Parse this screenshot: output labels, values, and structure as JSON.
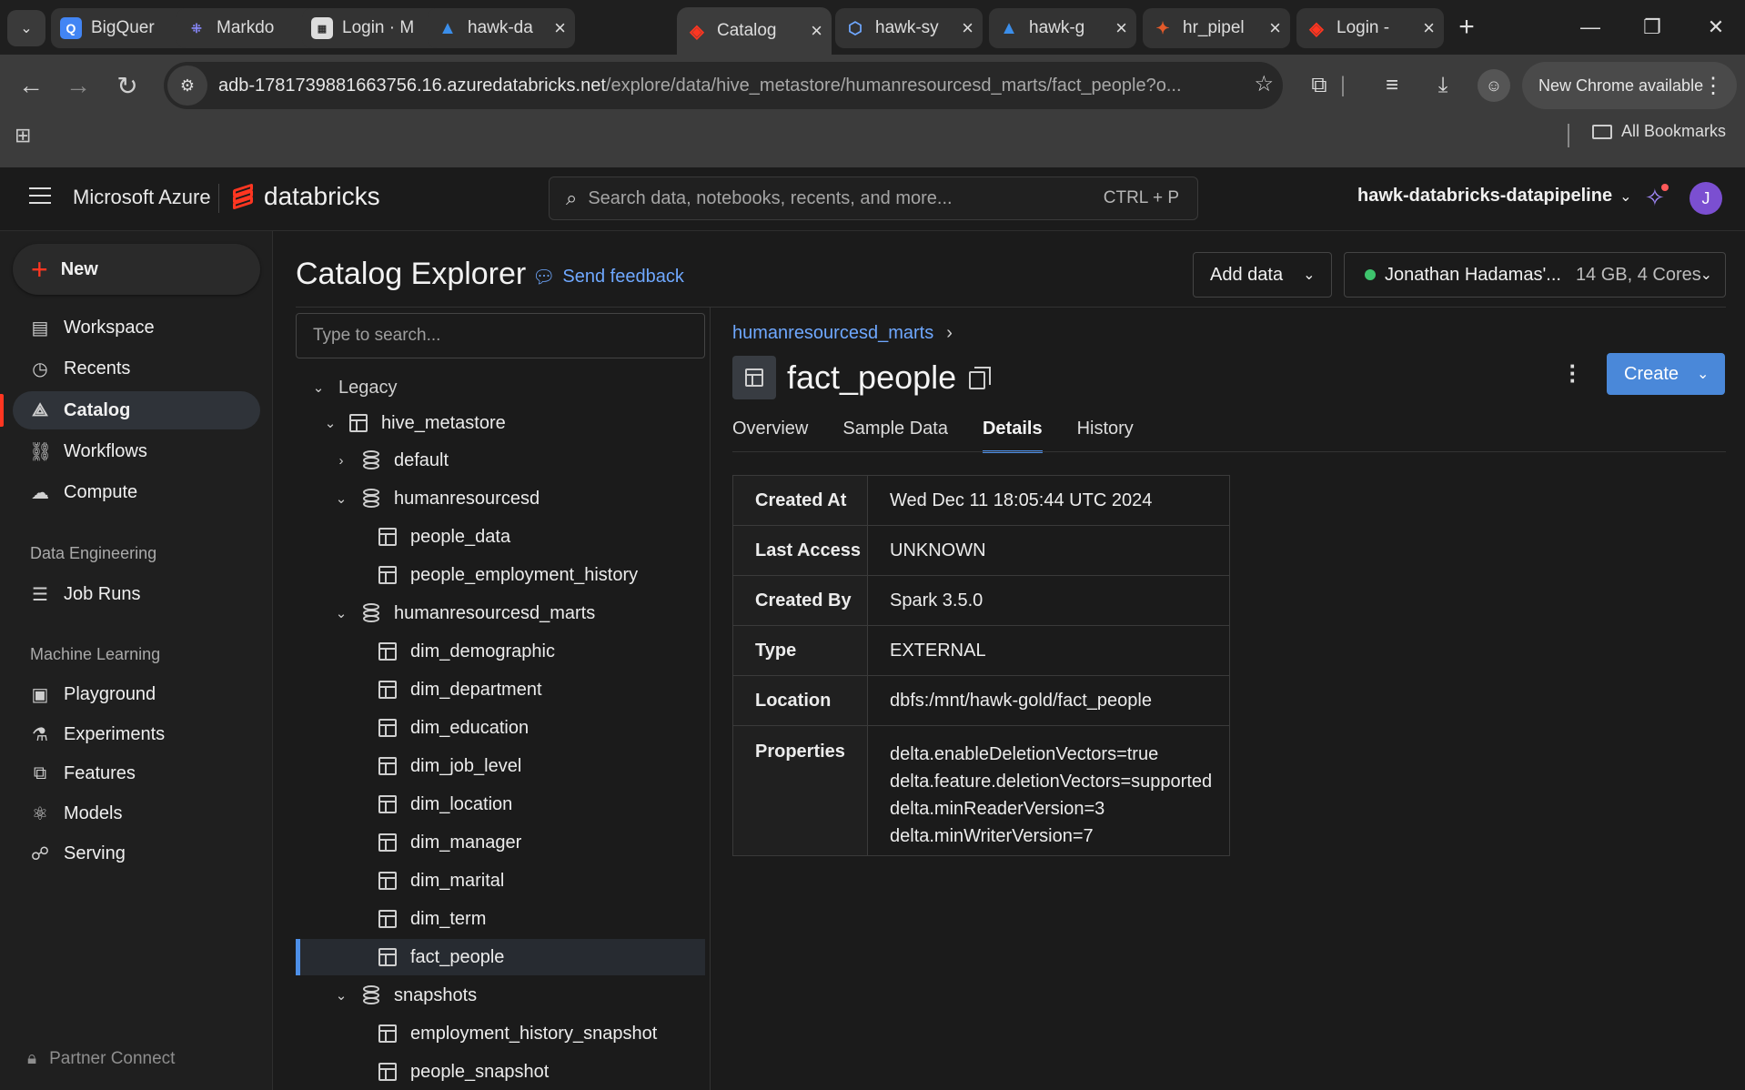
{
  "browser": {
    "tabs": [
      {
        "title": "BigQuer",
        "favicon": "bigquery-icon",
        "color": "#4285f4"
      },
      {
        "title": "Markdo",
        "favicon": "markdown-icon",
        "color": "#8a8aff"
      },
      {
        "title": "Login · M",
        "favicon": "page-icon",
        "color": "#cccccc"
      },
      {
        "title": "hawk-da",
        "favicon": "azure-icon",
        "color": "#3b8eea"
      },
      {
        "title": "Catalog",
        "favicon": "databricks-icon",
        "color": "#ff3621",
        "active": true
      },
      {
        "title": "hawk-sy",
        "favicon": "synapse-icon",
        "color": "#6fa8ff"
      },
      {
        "title": "hawk-g",
        "favicon": "azure-icon",
        "color": "#3b8eea"
      },
      {
        "title": "hr_pipel",
        "favicon": "pipeline-icon",
        "color": "#e35a2a"
      },
      {
        "title": "Login -",
        "favicon": "databricks-icon",
        "color": "#ff3621"
      }
    ],
    "url_host": "adb-1781739881663756.16.azuredatabricks.net",
    "url_path": "/explore/data/hive_metastore/humanresourcesd_marts/fact_people?o...",
    "update_label": "New Chrome available",
    "all_bookmarks": "All Bookmarks"
  },
  "topbar": {
    "cloud": "Microsoft Azure",
    "brand": "databricks",
    "search_placeholder": "Search data, notebooks, recents, and more...",
    "search_shortcut": "CTRL + P",
    "workspace": "hawk-databricks-datapipeline",
    "avatar_initial": "J"
  },
  "sidebar": {
    "new_label": "New",
    "items": [
      {
        "label": "Workspace",
        "icon": "workspace-icon"
      },
      {
        "label": "Recents",
        "icon": "clock-icon"
      },
      {
        "label": "Catalog",
        "icon": "catalog-icon",
        "active": true
      },
      {
        "label": "Workflows",
        "icon": "workflows-icon"
      },
      {
        "label": "Compute",
        "icon": "cloud-icon"
      }
    ],
    "section_data_engineering": "Data Engineering",
    "data_engineering_items": [
      {
        "label": "Job Runs",
        "icon": "job-runs-icon"
      }
    ],
    "section_ml": "Machine Learning",
    "ml_items": [
      {
        "label": "Playground",
        "icon": "playground-icon"
      },
      {
        "label": "Experiments",
        "icon": "flask-icon"
      },
      {
        "label": "Features",
        "icon": "features-icon"
      },
      {
        "label": "Models",
        "icon": "models-icon"
      },
      {
        "label": "Serving",
        "icon": "serving-icon"
      }
    ],
    "partner_connect": "Partner Connect"
  },
  "catalog": {
    "title": "Catalog Explorer",
    "feedback": "Send feedback",
    "add_data": "Add data",
    "compute_name": "Jonathan Hadamas'...",
    "compute_spec": "14 GB, 4 Cores",
    "tree_search_placeholder": "Type to search...",
    "tree": [
      {
        "label": "Legacy",
        "type": "group",
        "expanded": true
      },
      {
        "label": "hive_metastore",
        "type": "metastore",
        "expanded": true
      },
      {
        "label": "default",
        "type": "schema",
        "expanded": false
      },
      {
        "label": "humanresourcesd",
        "type": "schema",
        "expanded": true
      },
      {
        "label": "people_data",
        "type": "table"
      },
      {
        "label": "people_employment_history",
        "type": "table"
      },
      {
        "label": "humanresourcesd_marts",
        "type": "schema",
        "expanded": true
      },
      {
        "label": "dim_demographic",
        "type": "table"
      },
      {
        "label": "dim_department",
        "type": "table"
      },
      {
        "label": "dim_education",
        "type": "table"
      },
      {
        "label": "dim_job_level",
        "type": "table"
      },
      {
        "label": "dim_location",
        "type": "table"
      },
      {
        "label": "dim_manager",
        "type": "table"
      },
      {
        "label": "dim_marital",
        "type": "table"
      },
      {
        "label": "dim_term",
        "type": "table"
      },
      {
        "label": "fact_people",
        "type": "table",
        "selected": true
      },
      {
        "label": "snapshots",
        "type": "schema",
        "expanded": true
      },
      {
        "label": "employment_history_snapshot",
        "type": "table"
      },
      {
        "label": "people_snapshot",
        "type": "table"
      }
    ]
  },
  "detail": {
    "breadcrumb": "humanresourcesd_marts",
    "title": "fact_people",
    "create_label": "Create",
    "tabs": [
      "Overview",
      "Sample Data",
      "Details",
      "History"
    ],
    "active_tab": "Details",
    "rows": [
      {
        "key": "Created At",
        "value": "Wed Dec 11 18:05:44 UTC 2024"
      },
      {
        "key": "Last Access",
        "value": "UNKNOWN"
      },
      {
        "key": "Created By",
        "value": "Spark 3.5.0"
      },
      {
        "key": "Type",
        "value": "EXTERNAL"
      },
      {
        "key": "Location",
        "value": "dbfs:/mnt/hawk-gold/fact_people"
      }
    ],
    "properties_key": "Properties",
    "properties": [
      "delta.enableDeletionVectors=true",
      "delta.feature.deletionVectors=supported",
      "delta.minReaderVersion=3",
      "delta.minWriterVersion=7"
    ]
  },
  "colors": {
    "accent_red": "#ff3621",
    "link_blue": "#6fa8ff",
    "primary_button": "#4a88d9",
    "selection_bar": "#4d8fe8",
    "status_green": "#3ec46d"
  }
}
